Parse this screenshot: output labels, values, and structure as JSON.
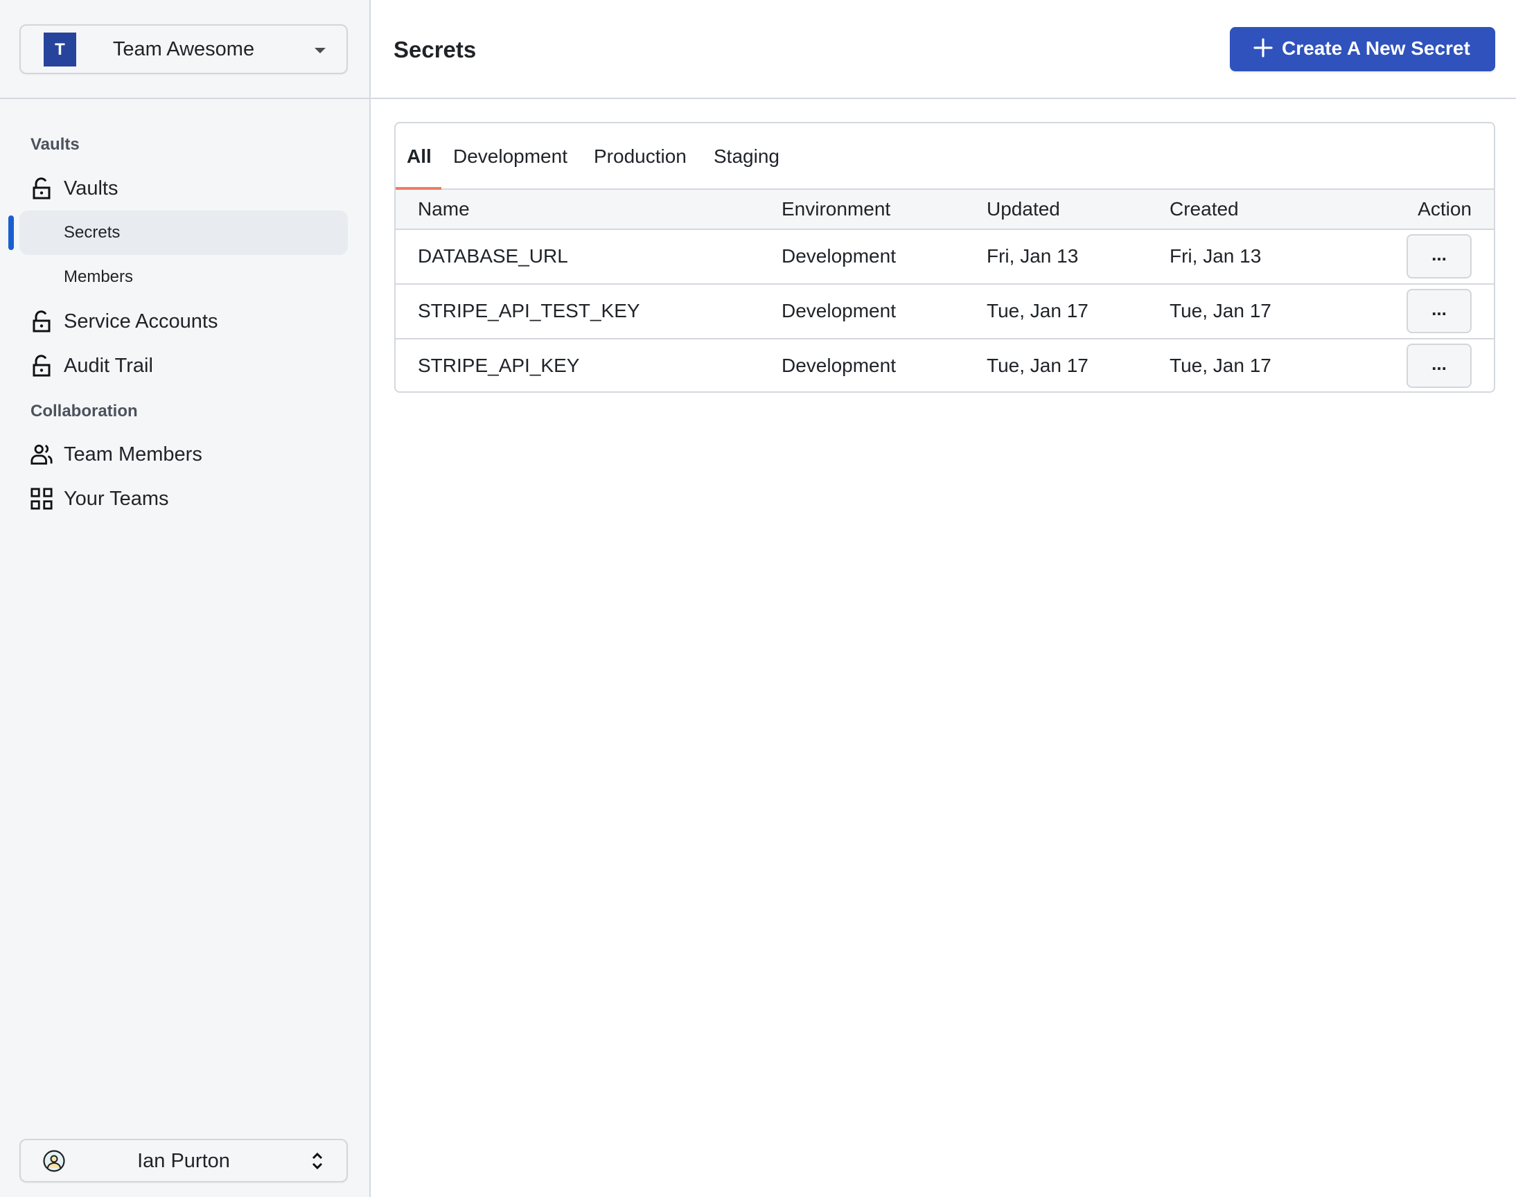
{
  "sidebar": {
    "team": {
      "avatar_letter": "T",
      "name": "Team Awesome",
      "avatar_color": "#27449c"
    },
    "sections": [
      {
        "label": "Vaults",
        "items": [
          {
            "label": "Vaults",
            "icon": "unlock-icon"
          },
          {
            "label": "Secrets",
            "active": true
          },
          {
            "label": "Members"
          },
          {
            "label": "Service Accounts",
            "icon": "unlock-icon"
          },
          {
            "label": "Audit Trail",
            "icon": "unlock-icon"
          }
        ]
      },
      {
        "label": "Collaboration",
        "items": [
          {
            "label": "Team Members",
            "icon": "users-icon"
          },
          {
            "label": "Your Teams",
            "icon": "grid-icon"
          }
        ]
      }
    ],
    "user": {
      "name": "Ian Purton",
      "icon": "user-avatar-icon"
    },
    "active_indicator_color": "#1a5fd0"
  },
  "header": {
    "title": "Secrets",
    "create_button_label": "Create A New Secret",
    "create_button_color": "#2f52bc"
  },
  "tabs": [
    {
      "label": "All",
      "active": true
    },
    {
      "label": "Development"
    },
    {
      "label": "Production"
    },
    {
      "label": "Staging"
    }
  ],
  "tab_underline_color": "#ef7c63",
  "table": {
    "columns": [
      "Name",
      "Environment",
      "Updated",
      "Created",
      "Action"
    ],
    "rows": [
      {
        "name": "DATABASE_URL",
        "environment": "Development",
        "updated": "Fri, Jan 13",
        "created": "Fri, Jan 13",
        "action": "..."
      },
      {
        "name": "STRIPE_API_TEST_KEY",
        "environment": "Development",
        "updated": "Tue, Jan 17",
        "created": "Tue, Jan 17",
        "action": "..."
      },
      {
        "name": "STRIPE_API_KEY",
        "environment": "Development",
        "updated": "Tue, Jan 17",
        "created": "Tue, Jan 17",
        "action": "..."
      }
    ]
  }
}
